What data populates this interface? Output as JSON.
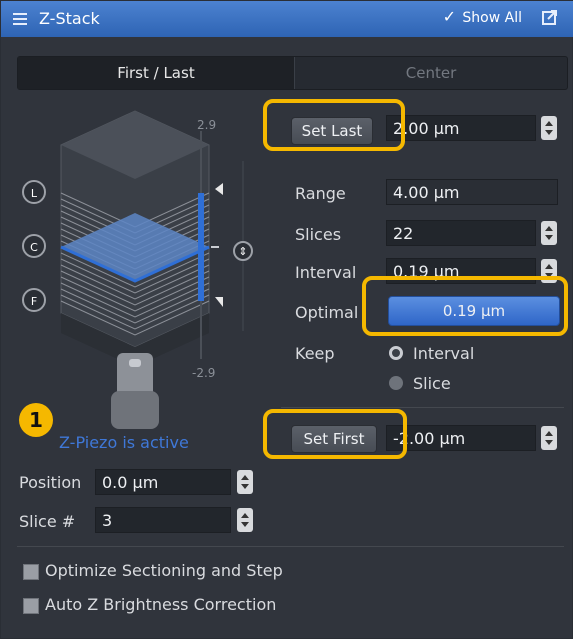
{
  "titlebar": {
    "title": "Z-Stack",
    "show_all": "Show All",
    "check_glyph": "✓"
  },
  "tabs": [
    {
      "label": "First / Last",
      "active": true
    },
    {
      "label": "Center",
      "active": false
    }
  ],
  "stack": {
    "top_value": "2.9",
    "bottom_value": "-2.9",
    "markers": {
      "last": "L",
      "center": "C",
      "first": "F"
    },
    "status": "Z-Piezo is active",
    "callout_number": "1"
  },
  "controls": {
    "set_last": {
      "label": "Set Last",
      "value": "2.00 µm"
    },
    "range": {
      "label": "Range",
      "value": "4.00 µm"
    },
    "slices": {
      "label": "Slices",
      "value": "22"
    },
    "interval": {
      "label": "Interval",
      "value": "0.19 µm"
    },
    "optimal": {
      "label": "Optimal",
      "value": "0.19 µm"
    },
    "keep": {
      "label": "Keep",
      "options": [
        {
          "label": "Interval",
          "selected": true
        },
        {
          "label": "Slice",
          "selected": false
        }
      ]
    },
    "set_first": {
      "label": "Set First",
      "value": "-2.00 µm"
    }
  },
  "position": {
    "label": "Position",
    "value": "0.0 µm"
  },
  "slice_number": {
    "label": "Slice #",
    "value": "3"
  },
  "options": [
    {
      "label": "Optimize Sectioning and Step",
      "checked": false
    },
    {
      "label": "Auto Z Brightness Correction",
      "checked": false
    }
  ],
  "colors": {
    "titlebar": "#3a74c8",
    "panel": "#30343c",
    "highlight": "#f5b800",
    "accent_blue": "#2f6fd6",
    "status_text": "#3f78d8"
  }
}
